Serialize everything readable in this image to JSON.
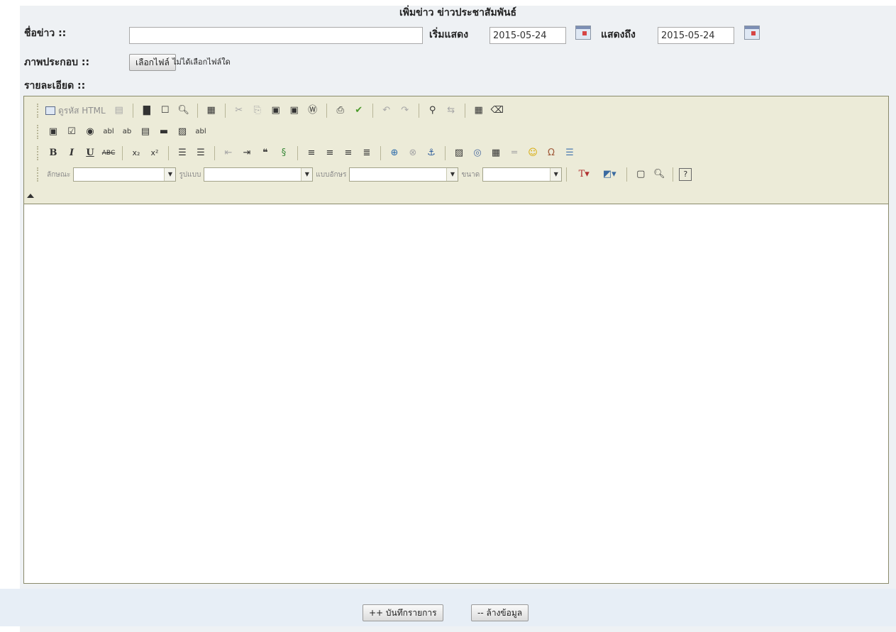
{
  "page": {
    "title": "เพิ่มข่าว ข่าวประชาสัมพันธ์"
  },
  "form": {
    "news_title_label": "ชื่อข่าว ::",
    "news_title_value": "",
    "start_label": "เริ่มแสดง",
    "start_date": "2015-05-24",
    "end_label": "แสดงถึง",
    "end_date": "2015-05-24",
    "image_label": "ภาพประกอบ ::",
    "choose_file_button": "เลือกไฟล์",
    "file_status": "ไม่ได้เลือกไฟล์ใด",
    "detail_label": "รายละเอียด ::"
  },
  "editor": {
    "source_button_label": "ดูรหัส HTML",
    "style_label": "ลักษณะ",
    "format_label": "รูปแบบ",
    "font_label": "แบบอักษร",
    "size_label": "ขนาด",
    "style_value": "",
    "format_value": "",
    "font_value": "",
    "size_value": "",
    "toolbar_row1_icons": [
      "source-icon",
      "templates-icon",
      "save-icon",
      "new-page-icon",
      "preview-icon",
      "paste-text-icon",
      "cut-icon",
      "copy-icon",
      "paste-icon",
      "paste-plain-icon",
      "paste-word-icon",
      "print-icon",
      "spellcheck-icon",
      "undo-icon",
      "redo-icon",
      "find-icon",
      "replace-icon",
      "select-all-icon",
      "remove-format-icon"
    ],
    "toolbar_row2_icons": [
      "form-icon",
      "checkbox-icon",
      "radio-icon",
      "textfield-icon",
      "textarea-icon",
      "select-icon",
      "button-icon",
      "image-button-icon",
      "hidden-field-icon"
    ],
    "toolbar_row3_icons": [
      "bold-icon",
      "italic-icon",
      "underline-icon",
      "strike-icon",
      "subscript-icon",
      "superscript-icon",
      "ordered-list-icon",
      "unordered-list-icon",
      "outdent-icon",
      "indent-icon",
      "blockquote-icon",
      "div-icon",
      "align-left-icon",
      "align-center-icon",
      "align-right-icon",
      "justify-icon",
      "link-icon",
      "unlink-icon",
      "anchor-icon",
      "image-icon",
      "flash-icon",
      "table-icon",
      "horizontal-rule-icon",
      "smiley-icon",
      "special-char-icon",
      "page-break-icon"
    ],
    "toolbar_row4_icons": [
      "text-color-icon",
      "bg-color-icon",
      "maximize-icon",
      "show-blocks-icon",
      "about-icon"
    ]
  },
  "footer": {
    "save_button": "++ บันทึกรายการ",
    "clear_button": "-- ล้างข้อมูล"
  }
}
